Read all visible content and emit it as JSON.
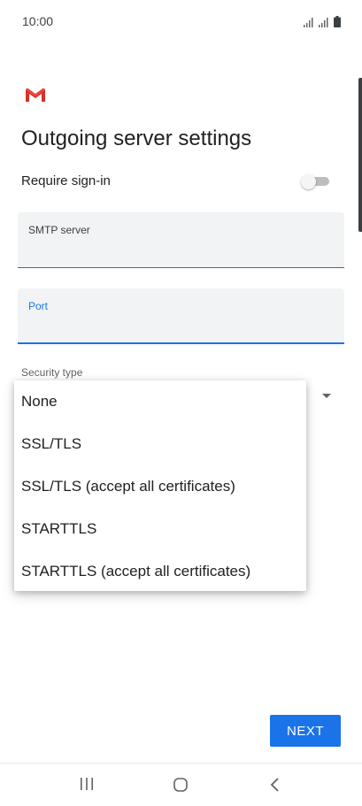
{
  "status_bar": {
    "time": "10:00",
    "icons": [
      "signal-icon",
      "signal-icon",
      "battery-icon"
    ]
  },
  "app": {
    "logo": "gmail-logo",
    "title": "Outgoing server settings"
  },
  "require_signin": {
    "label": "Require sign-in",
    "enabled": false
  },
  "fields": {
    "smtp": {
      "label": "SMTP server",
      "value": ""
    },
    "port": {
      "label": "Port",
      "value": ""
    }
  },
  "security": {
    "label": "Security type",
    "options": [
      "None",
      "SSL/TLS",
      "SSL/TLS (accept all certificates)",
      "STARTTLS",
      "STARTTLS (accept all certificates)"
    ]
  },
  "actions": {
    "next_label": "NEXT"
  },
  "navigation": {
    "icons": [
      "recents-icon",
      "home-icon",
      "back-icon"
    ]
  },
  "colors": {
    "accent": "#1a73e8",
    "gmail_red": "#d93025"
  }
}
